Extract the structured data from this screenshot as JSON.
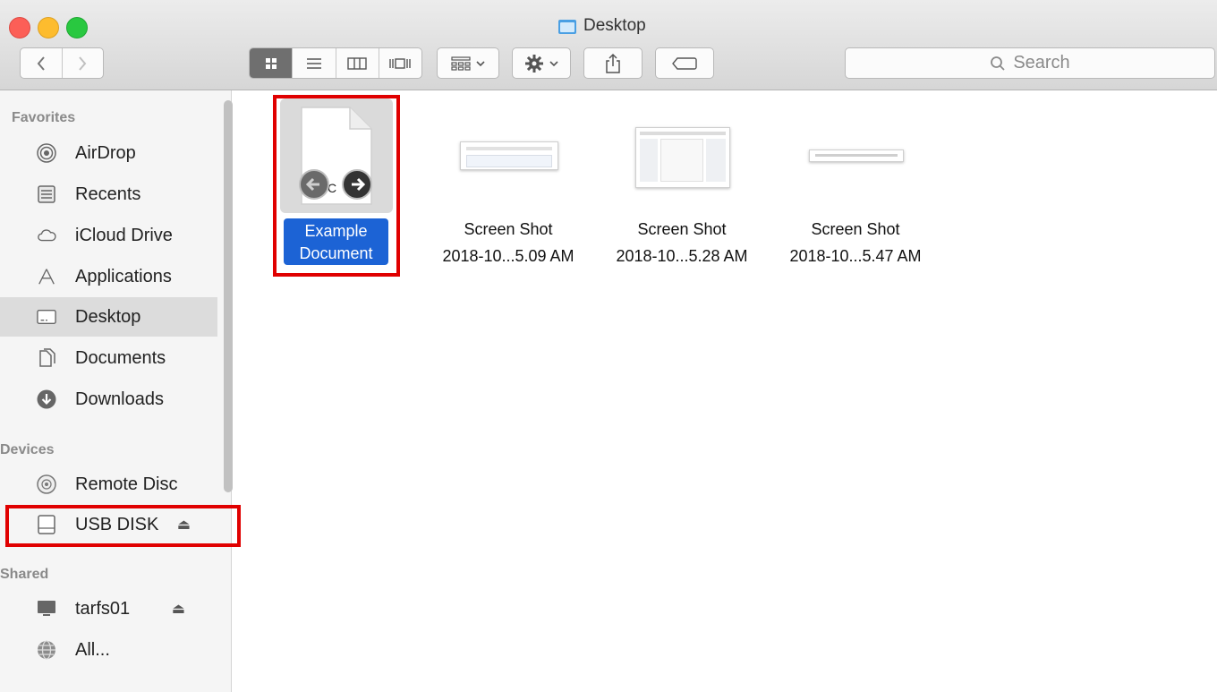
{
  "window": {
    "title": "Desktop"
  },
  "toolbar": {
    "back_label": "<",
    "forward_label": ">",
    "search_placeholder": "Search"
  },
  "sidebar": {
    "favorites_header": "Favorites",
    "favorites": [
      {
        "label": "AirDrop",
        "icon": "airdrop-icon"
      },
      {
        "label": "Recents",
        "icon": "recents-icon"
      },
      {
        "label": "iCloud Drive",
        "icon": "cloud-icon"
      },
      {
        "label": "Applications",
        "icon": "applications-icon"
      },
      {
        "label": "Desktop",
        "icon": "desktop-icon",
        "selected": true
      },
      {
        "label": "Documents",
        "icon": "documents-icon"
      },
      {
        "label": "Downloads",
        "icon": "downloads-icon"
      }
    ],
    "devices_header": "Devices",
    "devices": [
      {
        "label": "Remote Disc",
        "icon": "disc-icon"
      },
      {
        "label": "USB DISK",
        "icon": "drive-icon",
        "ejectable": true
      }
    ],
    "shared_header": "Shared",
    "shared": [
      {
        "label": "tarfs01",
        "icon": "monitor-icon",
        "ejectable": true
      },
      {
        "label": "All...",
        "icon": "network-icon"
      }
    ]
  },
  "files": [
    {
      "line1": "Example",
      "line2": "Document",
      "doc_badge": "DOC",
      "selected": true
    },
    {
      "line1": "Screen Shot",
      "line2": "2018-10...5.09 AM"
    },
    {
      "line1": "Screen Shot",
      "line2": "2018-10...5.28 AM"
    },
    {
      "line1": "Screen Shot",
      "line2": "2018-10...5.47 AM"
    }
  ],
  "colors": {
    "close": "#fc5f57",
    "minimize": "#fdbc2e",
    "zoom": "#29c840",
    "selection": "#1c63d5",
    "highlight_box": "#e00000",
    "folder_icon": "#4a9fe3"
  }
}
